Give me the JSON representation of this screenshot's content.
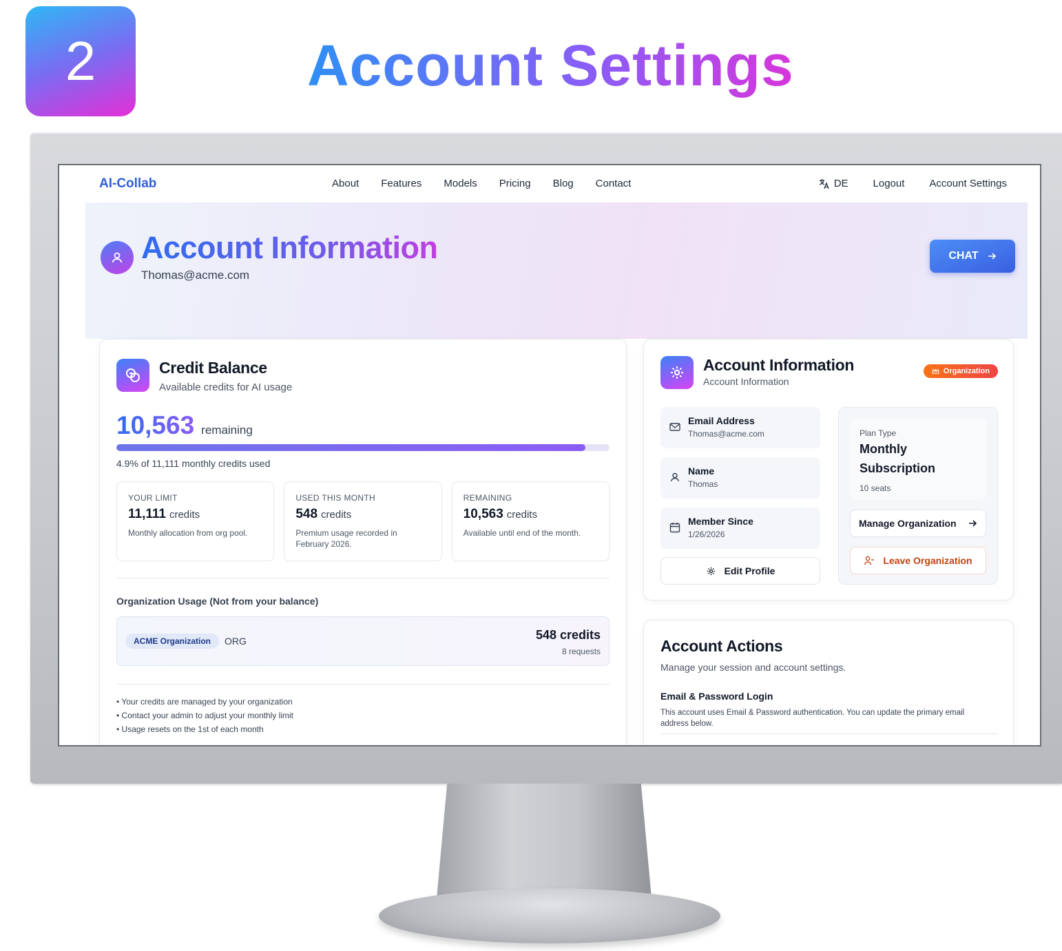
{
  "slide": {
    "step": "2",
    "title": "Account Settings"
  },
  "nav": {
    "logo": "AI-Collab",
    "links": [
      "About",
      "Features",
      "Models",
      "Pricing",
      "Blog",
      "Contact"
    ],
    "language": "DE",
    "logout": "Logout",
    "account_settings": "Account Settings"
  },
  "hero": {
    "title": "Account Information",
    "email": "Thomas@acme.com",
    "chat_button": "CHAT"
  },
  "credit_balance": {
    "title": "Credit Balance",
    "subtitle": "Available credits for AI usage",
    "remaining_value": "10,563",
    "remaining_label": "remaining",
    "used_fraction": 0.951,
    "usage_text": "4.9% of 11,111 monthly credits used",
    "stats": [
      {
        "label": "YOUR LIMIT",
        "value": "11,111",
        "unit": "credits",
        "desc": "Monthly allocation from org pool."
      },
      {
        "label": "USED THIS MONTH",
        "value": "548",
        "unit": "credits",
        "desc": "Premium usage recorded in February 2026."
      },
      {
        "label": "REMAINING",
        "value": "10,563",
        "unit": "credits",
        "desc": "Available until end of the month."
      }
    ],
    "org_usage_title": "Organization Usage (Not from your balance)",
    "org_usage": {
      "name": "ACME Organization",
      "tag": "ORG",
      "credits": "548 credits",
      "requests": "8 requests"
    },
    "notes": [
      "• Your credits are managed by your organization",
      "• Contact your admin to adjust your monthly limit",
      "• Usage resets on the 1st of each month"
    ]
  },
  "account_info": {
    "title": "Account Information",
    "subtitle": "Account Information",
    "badge": "Organization",
    "items": [
      {
        "label": "Email Address",
        "value": "Thomas@acme.com",
        "icon": "mail-icon"
      },
      {
        "label": "Name",
        "value": "Thomas",
        "icon": "user-icon"
      },
      {
        "label": "Member Since",
        "value": "1/26/2026",
        "icon": "calendar-icon"
      }
    ],
    "edit_profile": "Edit Profile",
    "plan": {
      "label": "Plan Type",
      "name": "Monthly Subscription",
      "seats": "10 seats"
    },
    "manage_org": "Manage Organization",
    "leave_org": "Leave Organization"
  },
  "account_actions": {
    "title": "Account Actions",
    "subtitle": "Manage your session and account settings.",
    "login_heading": "Email & Password Login",
    "login_desc": "This account uses Email & Password authentication. You can update the primary email address below."
  },
  "colors": {
    "accent_blue": "#2f6cf0",
    "accent_purple": "#8b5cf6",
    "accent_magenta": "#e52fd6",
    "danger_orange": "#c2410c"
  }
}
